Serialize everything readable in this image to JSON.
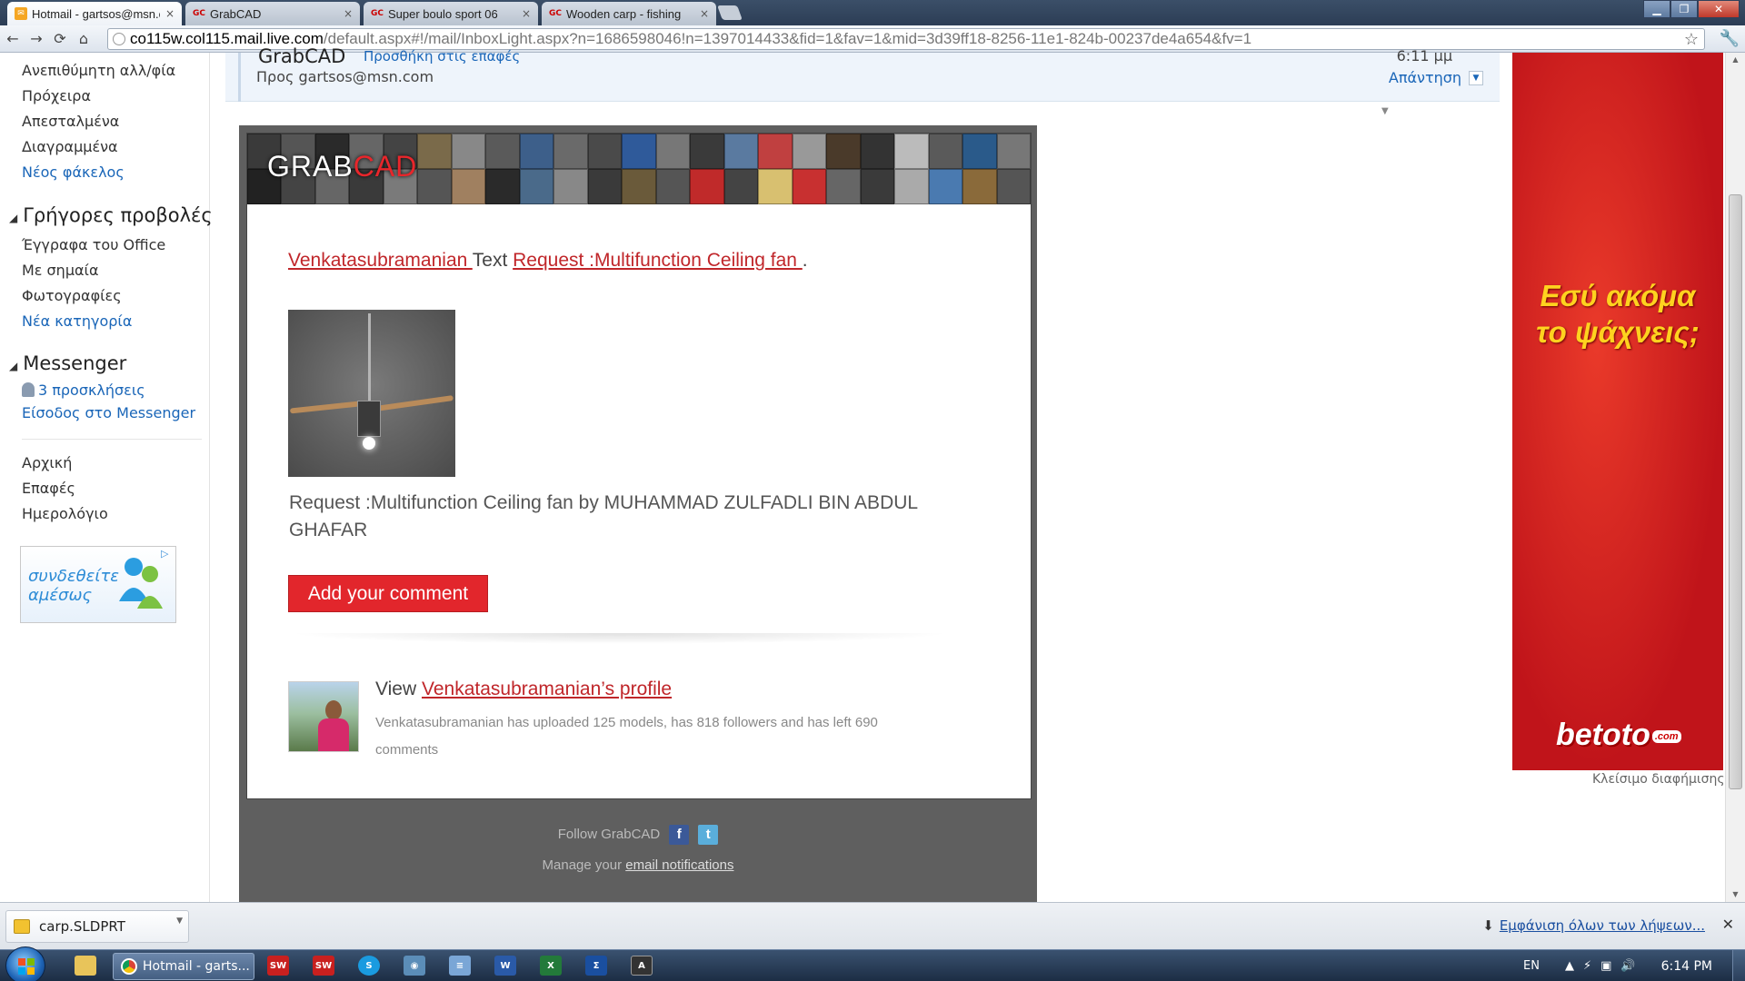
{
  "browser": {
    "tabs": [
      {
        "title": "Hotmail - gartsos@msn.com",
        "active": true,
        "icon": "mail-icon"
      },
      {
        "title": "GrabCAD",
        "active": false,
        "icon": "gc-icon"
      },
      {
        "title": "Super boulo sport 06",
        "active": false,
        "icon": "gc-icon"
      },
      {
        "title": "Wooden carp - fishing",
        "active": false,
        "icon": "gc-icon"
      }
    ],
    "tab_close": "×",
    "fav_gc": "GC",
    "url_host": "co115w.col115.mail.live.com",
    "url_path": "/default.aspx#!/mail/InboxLight.aspx?n=1686598046!n=1397014433&fid=1&fav=1&mid=3d39ff18-8256-11e1-824b-00237de4a654&fv=1",
    "back": "←",
    "forward": "→",
    "reload": "⟳",
    "home": "⌂",
    "star": "☆",
    "wrench": "🔧",
    "win_min": "▁",
    "win_max": "❐",
    "win_close": "✕"
  },
  "sidebar": {
    "items_top": [
      "Ανεπιθύμητη αλλ/φία",
      "Πρόχειρα",
      "Απεσταλμένα",
      "Διαγραμμένα"
    ],
    "new_folder": "Νέος φάκελος",
    "quick_views_heading": "Γρήγορες προβολές",
    "quick_views": [
      "Έγγραφα του Office",
      "Με σημαία",
      "Φωτογραφίες"
    ],
    "new_category": "Νέα κατηγορία",
    "messenger_heading": "Messenger",
    "messenger_invites": "3 προσκλήσεις",
    "messenger_signin": "Είσοδος στο Messenger",
    "bottom_links": [
      "Αρχική",
      "Επαφές",
      "Ημερολόγιο"
    ],
    "ad_text_line1": "συνδεθείτε",
    "ad_text_line2": "αμέσως",
    "tri": "◢"
  },
  "mail_header": {
    "sender": "GrabCAD",
    "add_contact": "Προσθήκη στις επαφές",
    "to": "Προς gartsos@msn.com",
    "time": "6:11 μμ",
    "reply": "Απάντηση",
    "reply_dd": "▼",
    "collapse": "▼"
  },
  "email": {
    "logo_grab": "GRAB",
    "logo_cad": "CAD",
    "user_name": "Venkatasubramanian ",
    "text_word": " Text ",
    "request_link": "Request :Multifunction Ceiling fan ",
    "period": ".",
    "description": "Request :Multifunction Ceiling fan by MUHAMMAD ZULFADLI BIN ABDUL GHAFAR",
    "comment_button": "Add your comment",
    "view_prefix": "View ",
    "profile_link": "Venkatasubramanian’s profile",
    "profile_stats": "Venkatasubramanian has uploaded 125 models, has 818 followers and has left 690 comments",
    "follow_text": "Follow GrabCAD",
    "fb": "f",
    "tw": "t",
    "manage_prefix": "Manage your ",
    "manage_link": "email notifications"
  },
  "ad": {
    "slogan_line1": "Εσύ ακόμα",
    "slogan_line2": "το ψάχνεις;",
    "brand": "betoto",
    "brand_suffix": ".com",
    "close_ad": "Κλείσιμο διαφήμισης"
  },
  "downloads": {
    "file": "carp.SLDPRT",
    "dd": "▼",
    "show_all": "Εμφάνιση όλων των λήψεων...",
    "arrow": "⬇",
    "close": "✕"
  },
  "taskbar": {
    "task_label": "Hotmail - garts...",
    "lang": "EN",
    "tray_up": "▲",
    "clock": "6:14 PM",
    "apps": [
      {
        "name": "explorer-icon",
        "label": "",
        "color": "#e8c45a"
      },
      {
        "name": "solidworks-icon",
        "label": "SW",
        "color": "#c8201f"
      },
      {
        "name": "solidworks-2-icon",
        "label": "SW",
        "color": "#c8201f"
      },
      {
        "name": "skype-icon",
        "label": "S",
        "color": "#1a9be0"
      },
      {
        "name": "network-icon",
        "label": "◉",
        "color": "#5b8db8"
      },
      {
        "name": "notepad-icon",
        "label": "≡",
        "color": "#7aa6d6"
      },
      {
        "name": "word-icon",
        "label": "W",
        "color": "#2a5aa8"
      },
      {
        "name": "excel-icon",
        "label": "X",
        "color": "#237a3a"
      },
      {
        "name": "sigma-icon",
        "label": "Σ",
        "color": "#1a4fa0"
      },
      {
        "name": "arch-icon",
        "label": "A",
        "color": "#333333"
      }
    ],
    "tray_symbols": [
      "⚡",
      "▣",
      "🔊"
    ]
  },
  "colors": {
    "grabcad_red": "#e2262c",
    "link_red": "#c0262a",
    "hotmail_link": "#1a66b8",
    "ad_red": "#d01c1c"
  }
}
